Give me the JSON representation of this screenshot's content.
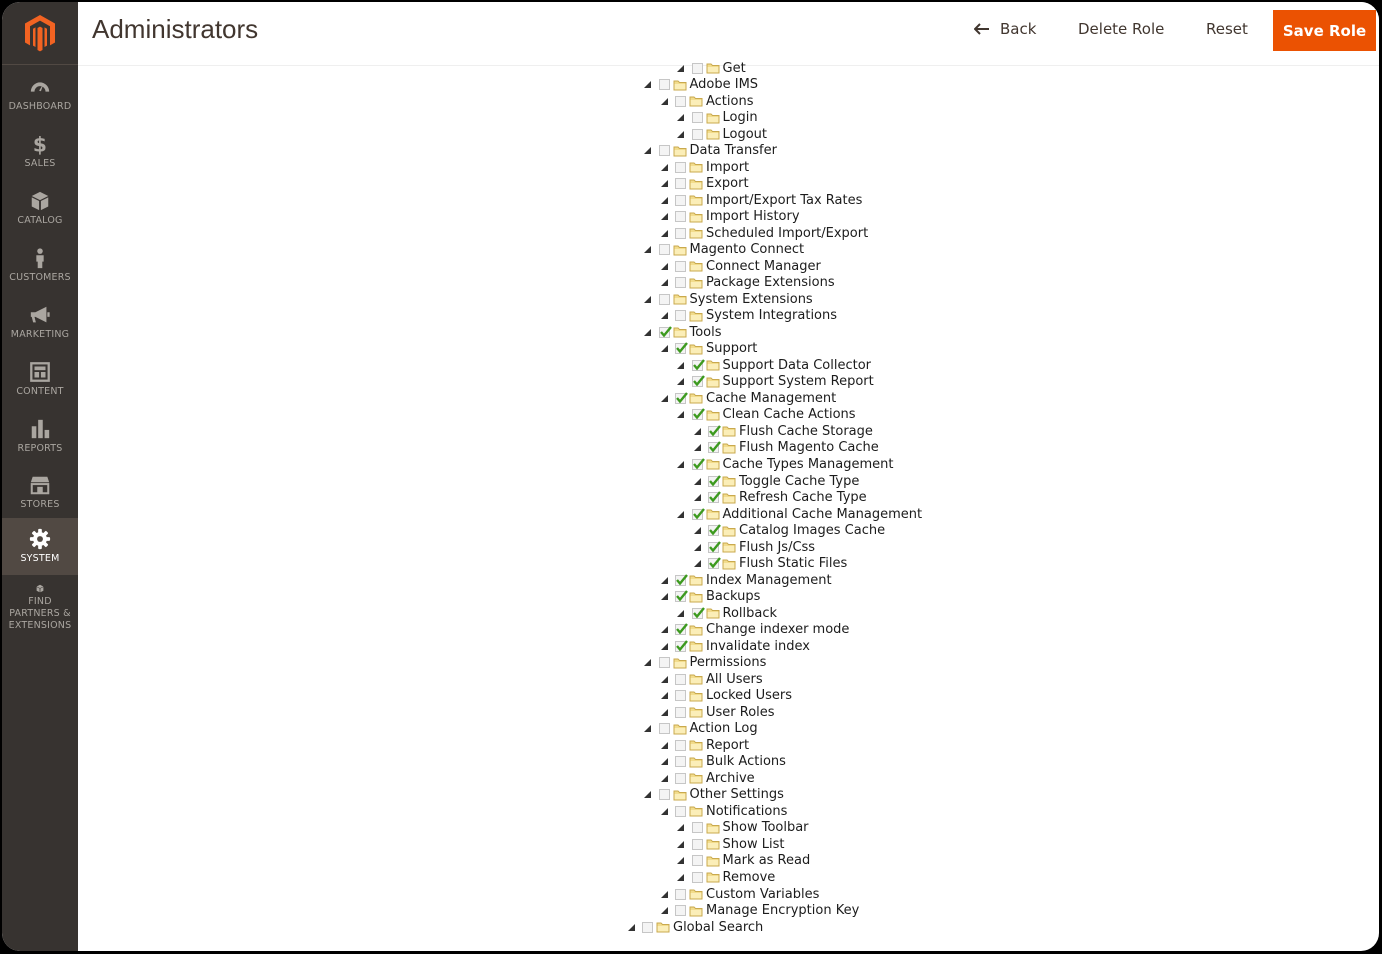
{
  "header": {
    "title": "Administrators",
    "back_label": "Back",
    "delete_label": "Delete Role",
    "reset_label": "Reset",
    "save_label": "Save Role"
  },
  "sidebar": {
    "items": [
      {
        "label": "DASHBOARD",
        "icon": "dashboard-icon"
      },
      {
        "label": "SALES",
        "icon": "dollar-icon"
      },
      {
        "label": "CATALOG",
        "icon": "box-icon"
      },
      {
        "label": "CUSTOMERS",
        "icon": "person-icon"
      },
      {
        "label": "MARKETING",
        "icon": "megaphone-icon"
      },
      {
        "label": "CONTENT",
        "icon": "layout-icon"
      },
      {
        "label": "REPORTS",
        "icon": "bar-chart-icon"
      },
      {
        "label": "STORES",
        "icon": "storefront-icon"
      },
      {
        "label": "SYSTEM",
        "icon": "gear-icon",
        "active": true
      },
      {
        "label": "FIND PARTNERS & EXTENSIONS",
        "icon": "package-icon"
      }
    ]
  },
  "colors": {
    "accent": "#eb5202",
    "sidebar": "#373330",
    "sidebar_active": "#514943",
    "check": "#3d9a1f"
  },
  "tree": [
    {
      "label": "Get",
      "level": 3,
      "checked": false
    },
    {
      "label": "Adobe IMS",
      "level": 1,
      "checked": false
    },
    {
      "label": "Actions",
      "level": 2,
      "checked": false
    },
    {
      "label": "Login",
      "level": 3,
      "checked": false
    },
    {
      "label": "Logout",
      "level": 3,
      "checked": false
    },
    {
      "label": "Data Transfer",
      "level": 1,
      "checked": false
    },
    {
      "label": "Import",
      "level": 2,
      "checked": false
    },
    {
      "label": "Export",
      "level": 2,
      "checked": false
    },
    {
      "label": "Import/Export Tax Rates",
      "level": 2,
      "checked": false
    },
    {
      "label": "Import History",
      "level": 2,
      "checked": false
    },
    {
      "label": "Scheduled Import/Export",
      "level": 2,
      "checked": false
    },
    {
      "label": "Magento Connect",
      "level": 1,
      "checked": false
    },
    {
      "label": "Connect Manager",
      "level": 2,
      "checked": false
    },
    {
      "label": "Package Extensions",
      "level": 2,
      "checked": false
    },
    {
      "label": "System Extensions",
      "level": 1,
      "checked": false
    },
    {
      "label": "System Integrations",
      "level": 2,
      "checked": false
    },
    {
      "label": "Tools",
      "level": 1,
      "checked": true
    },
    {
      "label": "Support",
      "level": 2,
      "checked": true
    },
    {
      "label": "Support Data Collector",
      "level": 3,
      "checked": true
    },
    {
      "label": "Support System Report",
      "level": 3,
      "checked": true
    },
    {
      "label": "Cache Management",
      "level": 2,
      "checked": true
    },
    {
      "label": "Clean Cache Actions",
      "level": 3,
      "checked": true
    },
    {
      "label": "Flush Cache Storage",
      "level": 4,
      "checked": true
    },
    {
      "label": "Flush Magento Cache",
      "level": 4,
      "checked": true
    },
    {
      "label": "Cache Types Management",
      "level": 3,
      "checked": true
    },
    {
      "label": "Toggle Cache Type",
      "level": 4,
      "checked": true
    },
    {
      "label": "Refresh Cache Type",
      "level": 4,
      "checked": true
    },
    {
      "label": "Additional Cache Management",
      "level": 3,
      "checked": true
    },
    {
      "label": "Catalog Images Cache",
      "level": 4,
      "checked": true
    },
    {
      "label": "Flush Js/Css",
      "level": 4,
      "checked": true
    },
    {
      "label": "Flush Static Files",
      "level": 4,
      "checked": true
    },
    {
      "label": "Index Management",
      "level": 2,
      "checked": true
    },
    {
      "label": "Backups",
      "level": 2,
      "checked": true
    },
    {
      "label": "Rollback",
      "level": 3,
      "checked": true
    },
    {
      "label": "Change indexer mode",
      "level": 2,
      "checked": true
    },
    {
      "label": "Invalidate index",
      "level": 2,
      "checked": true
    },
    {
      "label": "Permissions",
      "level": 1,
      "checked": false
    },
    {
      "label": "All Users",
      "level": 2,
      "checked": false
    },
    {
      "label": "Locked Users",
      "level": 2,
      "checked": false
    },
    {
      "label": "User Roles",
      "level": 2,
      "checked": false
    },
    {
      "label": "Action Log",
      "level": 1,
      "checked": false
    },
    {
      "label": "Report",
      "level": 2,
      "checked": false
    },
    {
      "label": "Bulk Actions",
      "level": 2,
      "checked": false
    },
    {
      "label": "Archive",
      "level": 2,
      "checked": false
    },
    {
      "label": "Other Settings",
      "level": 1,
      "checked": false
    },
    {
      "label": "Notifications",
      "level": 2,
      "checked": false
    },
    {
      "label": "Show Toolbar",
      "level": 3,
      "checked": false
    },
    {
      "label": "Show List",
      "level": 3,
      "checked": false
    },
    {
      "label": "Mark as Read",
      "level": 3,
      "checked": false
    },
    {
      "label": "Remove",
      "level": 3,
      "checked": false
    },
    {
      "label": "Custom Variables",
      "level": 2,
      "checked": false
    },
    {
      "label": "Manage Encryption Key",
      "level": 2,
      "checked": false
    },
    {
      "label": "Global Search",
      "level": 0,
      "checked": false
    }
  ]
}
